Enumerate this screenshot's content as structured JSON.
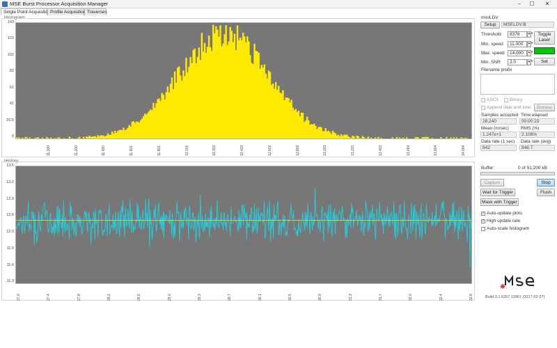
{
  "window": {
    "title": "MSE Burst Processor Acquisition Manager",
    "controls": [
      "–",
      "☐",
      "✕"
    ]
  },
  "tabs": [
    {
      "label": "Single Point Acquisition",
      "active": true
    },
    {
      "label": "Profile Acquisition",
      "active": false
    },
    {
      "label": "Traverses",
      "active": false
    }
  ],
  "histogram": {
    "label": "Histogram",
    "y_ticks": [
      "143",
      "123",
      "102",
      "82",
      "61",
      "41",
      "20.5",
      "0"
    ],
    "x_ticks": [
      "11.100",
      "11.200",
      "11.420",
      "11.601",
      "11.801",
      "12.101",
      "12.322",
      "12.422",
      "12.602",
      "12.803",
      "13.023",
      "13.223",
      "13.403",
      "13.664",
      "13.804",
      "14.004"
    ],
    "fill_color": "#ffea00",
    "bg_color": "#777777"
  },
  "history": {
    "label": "History",
    "y_ticks": [
      "13.5",
      "13.2",
      "12.9",
      "12.6",
      "12.3",
      "11.9",
      "11.6",
      "11.3"
    ],
    "x_ticks": [
      "27.0",
      "27.4",
      "27.8",
      "28.2",
      "28.6",
      "29.0",
      "29.3",
      "29.7",
      "30.1",
      "30.5",
      "30.9",
      "31.3",
      "31.7",
      "32.0",
      "32.4",
      "32.8"
    ],
    "mean_value": 12.5,
    "line_color": "#1fd0e0",
    "mean_color": "#e0c830"
  },
  "chart_data": [
    {
      "type": "bar",
      "title": "Histogram",
      "xlabel": "",
      "ylabel": "",
      "ylim": [
        0,
        143
      ],
      "x_range": [
        11.0,
        14.2
      ],
      "distribution": {
        "center": 12.45,
        "sigma": 0.32,
        "peak": 128
      },
      "grid": false
    },
    {
      "type": "line",
      "title": "History",
      "xlabel": "",
      "ylabel": "",
      "ylim": [
        11.1,
        13.7
      ],
      "x_range": [
        27.0,
        32.8
      ],
      "series": [
        {
          "mean": 12.5,
          "spread": 0.26
        }
      ],
      "grid": false
    }
  ],
  "panel": {
    "group_label": "miniLDV",
    "setup_label": "Setup",
    "device_name": "MSELDV:B",
    "threshold_label": "Threshold",
    "threshold_value": "8376",
    "toggle_laser_label": "Toggle\nLaser",
    "min_speed_label": "Min. speed",
    "min_speed_value": "11.000",
    "max_speed_label": "Max. speed",
    "max_speed_value": "14.000",
    "laser_color": "#00c800",
    "min_snr_label": "Min. SNR",
    "min_snr_value": "2.0",
    "set_label": "Set",
    "filename_prefix_label": "Filename prefix",
    "ascii_label": "ASCII",
    "binary_label": "Binary",
    "append_date_label": "Append date and time",
    "browse_label": "Browse",
    "samples_accepted_label": "Samples accepted",
    "samples_accepted_value": "28,240",
    "time_elapsed_label": "Time elapsed",
    "time_elapsed_value": "00:00:23",
    "mean_label": "Mean (m/sec)",
    "mean_value": "1.247e+1",
    "rms_label": "RMS (%)",
    "rms_value": "2.108%",
    "data_rate_1s_label": "Data rate (1 sec)",
    "data_rate_1s_value": "842",
    "data_rate_avg_label": "Data rate (avg)",
    "data_rate_avg_value": "846.7",
    "buffer_label": "Buffer:",
    "buffer_value": "0 of 51,200 kB",
    "buffer_fill": 0.0,
    "capture_label": "Capture",
    "stop_label": "Stop",
    "wait_trigger_label": "Wait for Trigger",
    "flush_label": "Flush",
    "mask_trigger_label": "Mask with Trigger",
    "auto_update_label": "Auto-update plots",
    "high_rate_label": "High update rate",
    "auto_scale_label": "Auto-scale histogram",
    "build_text": "Build 3.1.6267.13961 (2017-02-27)"
  }
}
